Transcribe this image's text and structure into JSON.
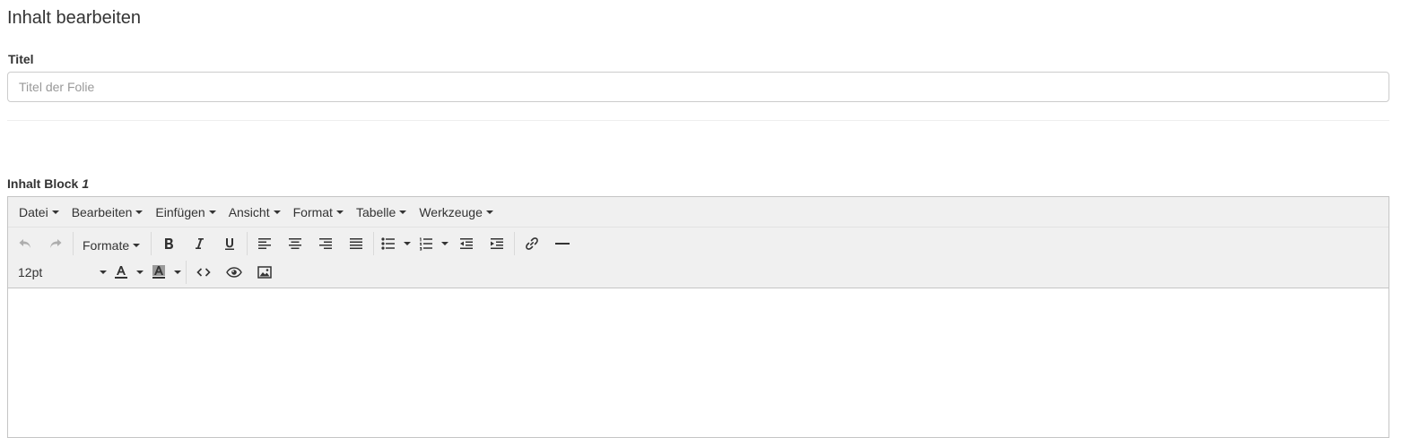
{
  "page": {
    "title": "Inhalt bearbeiten"
  },
  "title_field": {
    "label": "Titel",
    "placeholder": "Titel der Folie",
    "value": ""
  },
  "block": {
    "label": "Inhalt Block",
    "number": "1"
  },
  "menubar": {
    "items": [
      {
        "label": "Datei"
      },
      {
        "label": "Bearbeiten"
      },
      {
        "label": "Einfügen"
      },
      {
        "label": "Ansicht"
      },
      {
        "label": "Format"
      },
      {
        "label": "Tabelle"
      },
      {
        "label": "Werkzeuge"
      }
    ]
  },
  "toolbar": {
    "formats_label": "Formate",
    "font_size": "12pt",
    "icons": [
      "undo-icon",
      "redo-icon",
      "bold-icon",
      "italic-icon",
      "underline-icon",
      "align-left-icon",
      "align-center-icon",
      "align-right-icon",
      "align-justify-icon",
      "bullet-list-icon",
      "numbered-list-icon",
      "outdent-icon",
      "indent-icon",
      "link-icon",
      "horizontal-rule-icon",
      "text-color-icon",
      "background-color-icon",
      "code-icon",
      "preview-icon",
      "image-icon"
    ]
  },
  "colors": {
    "toolbar_bg": "#f0f0f0",
    "border": "#c5c5c5",
    "text": "#333333",
    "placeholder": "#999999"
  },
  "editor": {
    "content": ""
  }
}
